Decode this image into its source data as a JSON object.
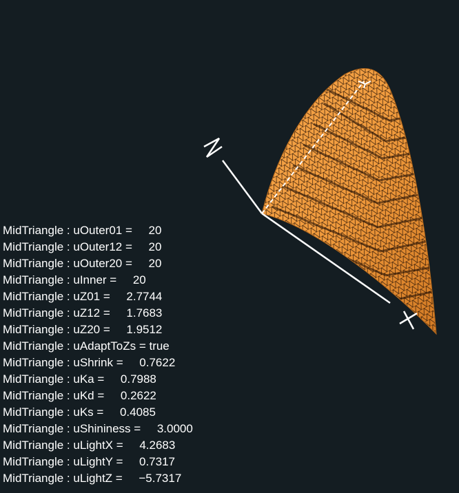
{
  "scene": {
    "mesh_color": "#f09a3c",
    "mesh_line_color": "#000000",
    "axis_color": "#ffffff",
    "background": "#141d22",
    "axis_labels": [
      "X",
      "Y",
      "Z"
    ]
  },
  "uniforms": [
    {
      "object": "MidTriangle",
      "name": "uOuter01",
      "value": "20"
    },
    {
      "object": "MidTriangle",
      "name": "uOuter12",
      "value": "20"
    },
    {
      "object": "MidTriangle",
      "name": "uOuter20",
      "value": "20"
    },
    {
      "object": "MidTriangle",
      "name": "uInner",
      "value": "20"
    },
    {
      "object": "MidTriangle",
      "name": "uZ01",
      "value": "2.7744"
    },
    {
      "object": "MidTriangle",
      "name": "uZ12",
      "value": "1.7683"
    },
    {
      "object": "MidTriangle",
      "name": "uZ20",
      "value": "1.9512"
    },
    {
      "object": "MidTriangle",
      "name": "uAdaptToZs",
      "value": "true"
    },
    {
      "object": "MidTriangle",
      "name": "uShrink",
      "value": "0.7622"
    },
    {
      "object": "MidTriangle",
      "name": "uKa",
      "value": "0.7988"
    },
    {
      "object": "MidTriangle",
      "name": "uKd",
      "value": "0.2622"
    },
    {
      "object": "MidTriangle",
      "name": "uKs",
      "value": "0.4085"
    },
    {
      "object": "MidTriangle",
      "name": "uShininess",
      "value": "3.0000"
    },
    {
      "object": "MidTriangle",
      "name": "uLightX",
      "value": "4.2683"
    },
    {
      "object": "MidTriangle",
      "name": "uLightY",
      "value": "0.7317"
    },
    {
      "object": "MidTriangle",
      "name": "uLightZ",
      "value": "-5.7317"
    }
  ]
}
